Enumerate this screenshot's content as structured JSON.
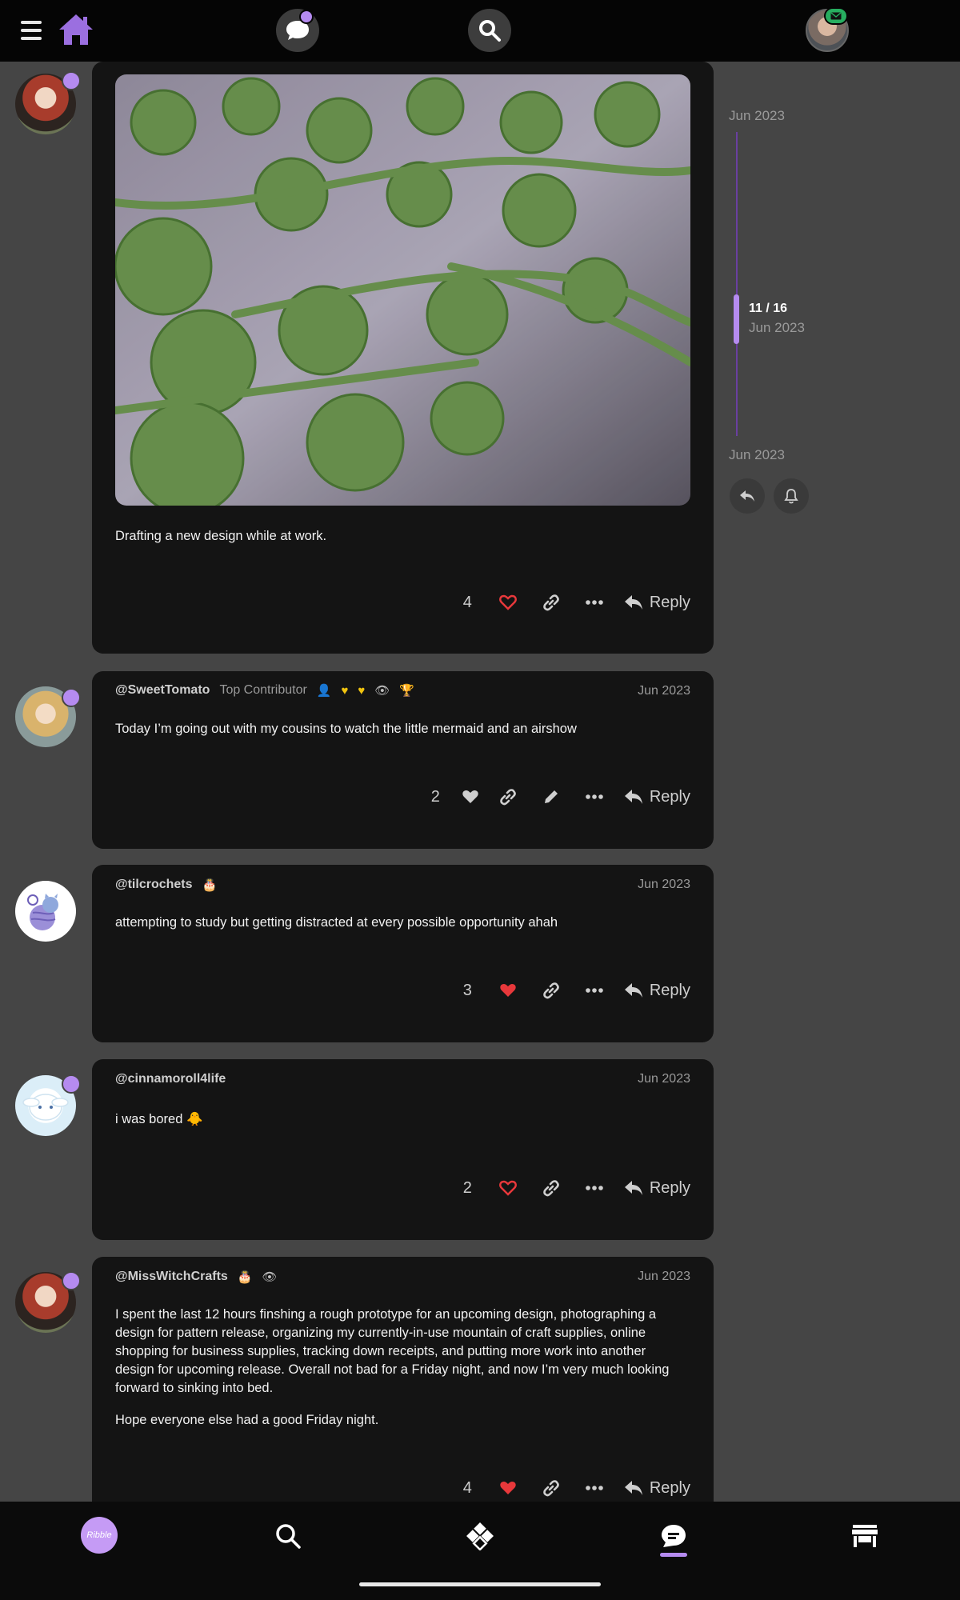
{
  "topbar": {
    "menu_icon": "hamburger-icon",
    "home_icon": "home-icon",
    "chat_icon": "chat-bubble-icon",
    "search_icon": "search-icon",
    "mail_icon": "mail-icon"
  },
  "timeline": {
    "start_date": "Jun 2023",
    "position": "11 / 16",
    "position_date": "Jun 2023",
    "end_date": "Jun 2023"
  },
  "posts": [
    {
      "text": "Drafting a new design while at work.",
      "likes": "4",
      "liked": false,
      "reply": "Reply"
    },
    {
      "username": "@SweetTomato",
      "title": "Top Contributor",
      "date": "Jun 2023",
      "text": "Today I’m going out with my cousins to watch the little mermaid and an airshow",
      "likes": "2",
      "reply": "Reply"
    },
    {
      "username": "@tilcrochets",
      "date": "Jun 2023",
      "text": "attempting to study but getting distracted at every possible opportunity ahah",
      "likes": "3",
      "reply": "Reply"
    },
    {
      "username": "@cinnamoroll4life",
      "date": "Jun 2023",
      "text": "i was bored 🐥",
      "likes": "2",
      "reply": "Reply"
    },
    {
      "username": "@MissWitchCrafts",
      "date": "Jun 2023",
      "text": "I spent the last 12 hours finshing a rough prototype for an upcoming design, photographing a design for pattern release, organizing my currently-in-use mountain of craft supplies, online shopping for business supplies, tracking down receipts, and putting more work into another design for upcoming release. Overall not bad for a Friday night, and now I’m very much looking forward to sinking into bed.",
      "text2": "Hope everyone else had a good Friday night.",
      "likes": "4",
      "reply": "Reply"
    }
  ],
  "bottombar": {
    "ribble_label": "Ribble"
  },
  "colors": {
    "accent": "#b58bf0",
    "heart_red": "#e8383b",
    "badge_green": "#27ae60"
  }
}
